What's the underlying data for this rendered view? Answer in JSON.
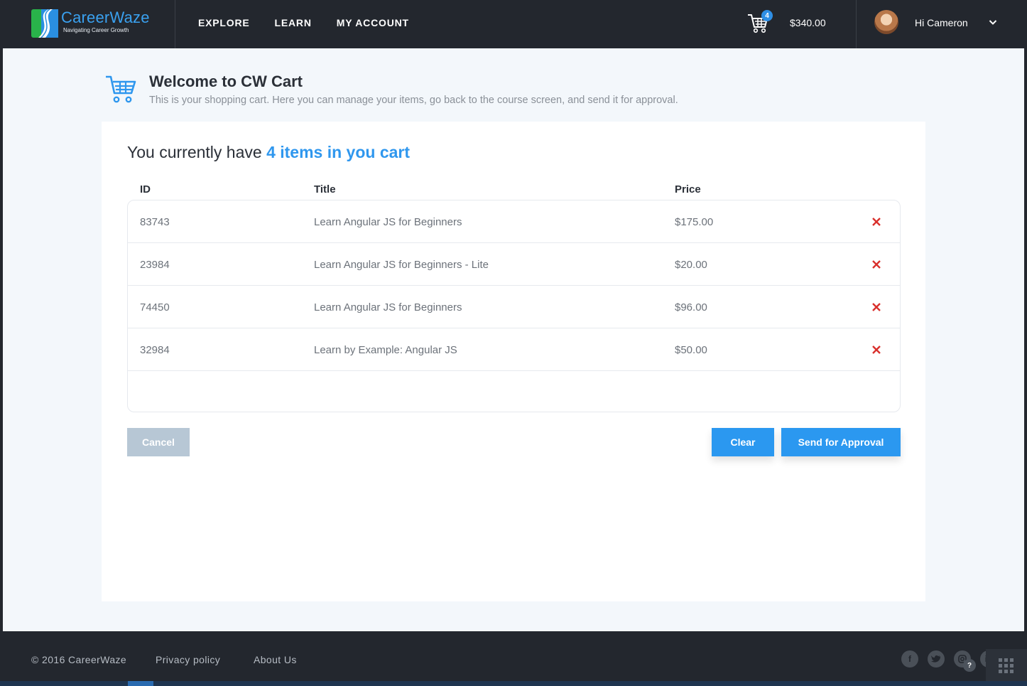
{
  "app": {
    "logo_name": "CareerWaze",
    "logo_tagline": "Navigating Career Growth",
    "accent": "#2b98f0"
  },
  "nav": {
    "items": [
      {
        "label": "EXPLORE"
      },
      {
        "label": "LEARN"
      },
      {
        "label": "MY ACCOUNT"
      }
    ]
  },
  "header": {
    "cart_count": "4",
    "cart_total": "$340.00",
    "greeting": "Hi Cameron"
  },
  "page": {
    "title": "Welcome to CW Cart",
    "subtitle": "This is your shopping cart. Here you can manage your items, go back to the course screen, and send it for approval."
  },
  "cart": {
    "summary_prefix": "You currently have",
    "summary_highlight": "4 items in you cart",
    "columns": {
      "id": "ID",
      "title": "Title",
      "price": "Price"
    },
    "items": [
      {
        "id": "83743",
        "title": "Learn Angular JS for Beginners",
        "price": "$175.00"
      },
      {
        "id": "23984",
        "title": "Learn Angular JS for Beginners - Lite",
        "price": "$20.00"
      },
      {
        "id": "74450",
        "title": "Learn Angular JS for Beginners",
        "price": "$96.00"
      },
      {
        "id": "32984",
        "title": "Learn by Example: Angular JS",
        "price": "$50.00"
      }
    ],
    "buttons": {
      "cancel": "Cancel",
      "clear": "Clear",
      "send": "Send for Approval"
    }
  },
  "footer": {
    "copyright": "© 2016 CareerWaze",
    "links": [
      {
        "label": "Privacy policy"
      },
      {
        "label": "About Us"
      }
    ],
    "social_icons": [
      "facebook-icon",
      "twitter-icon",
      "instagram-icon",
      "linkedin-icon"
    ],
    "help_label": "?"
  }
}
